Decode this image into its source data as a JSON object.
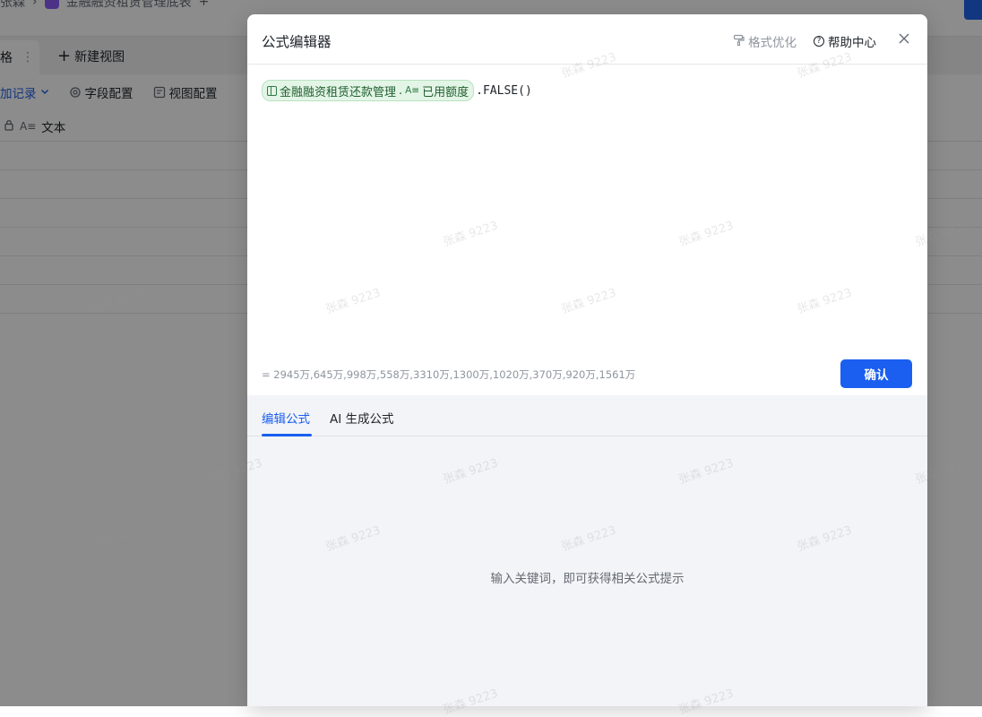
{
  "background": {
    "breadcrumb": [
      "张森",
      "金融融资租赁管理底表",
      "+"
    ],
    "tab_active": "格",
    "tab_menu_glyph": "⋮",
    "tab_new": "新建视图",
    "toolbar": [
      {
        "label": "加记录",
        "icon": "chevron-down-icon"
      },
      {
        "label": "字段配置",
        "icon": "gear-icon"
      },
      {
        "label": "视图配置",
        "icon": "view-config-icon"
      }
    ],
    "column_header": "文本"
  },
  "modal": {
    "title": "公式编辑器",
    "format_label": "格式优化",
    "help_label": "帮助中心",
    "formula": {
      "chip_table": "金融融资租赁还款管理",
      "chip_sep": ".",
      "chip_field_type": "A≡",
      "chip_field": "已用额度",
      "rest": ".FALSE()"
    },
    "result": "= 2945万,645万,998万,558万,3310万,1300万,1020万,370万,920万,1561万",
    "confirm_label": "确认",
    "tabs": [
      {
        "label": "编辑公式",
        "active": true
      },
      {
        "label": "AI 生成公式",
        "active": false
      }
    ],
    "empty_hint": "输入关键词，即可获得相关公式提示"
  },
  "watermark": "张森 9223",
  "colors": {
    "primary": "#1a5ff0",
    "chip_bg": "#e3f5e6",
    "chip_text": "#1f5f2f",
    "overlay": "rgba(0,0,0,0.45)"
  }
}
